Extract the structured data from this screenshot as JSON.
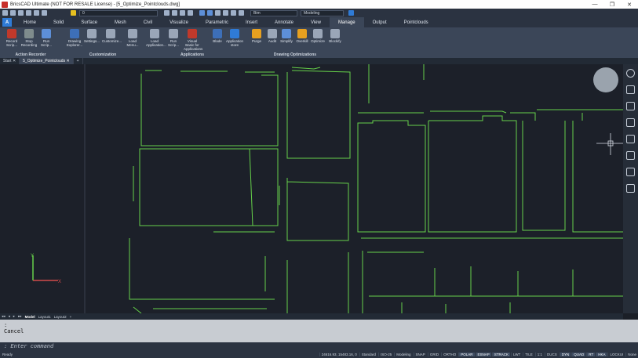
{
  "window": {
    "title": "BricsCAD Ultimate (NOT FOR RESALE License) - [5_Optimize_Pointclouds.dwg]",
    "controls": [
      "—",
      "❐",
      "✕"
    ]
  },
  "qat": {
    "layer_value": "0",
    "linetype_value": "Bim",
    "workspace_value": "Modeling"
  },
  "ribbon_tabs": [
    "Home",
    "Solid",
    "Surface",
    "Mesh",
    "Civil",
    "Visualize",
    "Parametric",
    "Insert",
    "Annotate",
    "View",
    "Manage",
    "Output",
    "Pointclouds"
  ],
  "active_tab": "Manage",
  "app_button": "A",
  "ribbon": {
    "buttons": [
      {
        "label": "Record Scrip...",
        "icon": "record-icon",
        "color": "#c0392b"
      },
      {
        "label": "Stop Recording",
        "icon": "stop-icon",
        "color": "#7f8c8d"
      },
      {
        "label": "Run Scrip...",
        "icon": "run-icon",
        "color": "#5d8fd8"
      },
      {
        "label": "Drawing Explorer...",
        "icon": "explorer-icon",
        "color": "#3d6fb8"
      },
      {
        "label": "Settings...",
        "icon": "settings-icon",
        "color": "#9aa6b8"
      },
      {
        "label": "Customize...",
        "icon": "customize-icon",
        "color": "#9aa6b8"
      },
      {
        "label": "Load Menu...",
        "icon": "load-menu-icon",
        "color": "#9aa6b8"
      },
      {
        "label": "Load Application...",
        "icon": "load-app-icon",
        "color": "#9aa6b8"
      },
      {
        "label": "Run Scrip...",
        "icon": "run-script-icon",
        "color": "#9aa6b8"
      },
      {
        "label": "Visual Basic for Applications",
        "icon": "vba-icon",
        "color": "#c0392b"
      },
      {
        "label": "Blade",
        "icon": "blade-icon",
        "color": "#3d6fb8"
      },
      {
        "label": "Application store",
        "icon": "app-store-icon",
        "color": "#2f7bd6"
      },
      {
        "label": "Purge",
        "icon": "purge-icon",
        "color": "#e6a020"
      },
      {
        "label": "Audit",
        "icon": "audit-icon",
        "color": "#9aa6b8"
      },
      {
        "label": "Simplify",
        "icon": "simplify-icon",
        "color": "#5d8fd8"
      },
      {
        "label": "Overkill",
        "icon": "overkill-icon",
        "color": "#e6a020"
      },
      {
        "label": "Optimize",
        "icon": "optimize-icon",
        "color": "#9aa6b8"
      },
      {
        "label": "Blockify",
        "icon": "blockify-icon",
        "color": "#9aa6b8"
      }
    ],
    "groups": [
      "Action Recorder",
      "Customization",
      "Applications",
      "Drawing Optimizations"
    ]
  },
  "doc_tabs": {
    "start": "Start",
    "active": "5_Optimize_Pointclouds",
    "add": "+"
  },
  "layout_tabs": {
    "nav": [
      "◂◂",
      "◂",
      "▸",
      "▸▸"
    ],
    "tabs": [
      "Model",
      "Layout1",
      "Layout2"
    ],
    "active": "Model",
    "add": "+"
  },
  "command": {
    "history": [
      ":",
      "Cancel"
    ],
    "prompt": ": Enter command"
  },
  "status": {
    "ready": "Ready",
    "coords": "24616.93, 15483.16, 0",
    "items": [
      "Standard",
      "ISO-25",
      "Modeling",
      "SNAP",
      "GRID",
      "ORTHO",
      "POLAR",
      "ESNAP",
      "STRACK",
      "LWT",
      "TILE",
      "1:1",
      "DUCS",
      "DYN",
      "QUAD",
      "RT",
      "HKA",
      "LOCKUI",
      "None"
    ],
    "on_items": [
      "POLAR",
      "ESNAP",
      "STRACK",
      "DYN",
      "QUAD",
      "RT",
      "HKA"
    ]
  },
  "colors": {
    "linework": "#66d14a",
    "background": "#1c2029",
    "accent": "#2f7bd6"
  }
}
